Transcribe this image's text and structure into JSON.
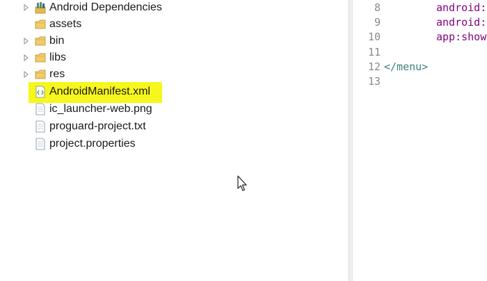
{
  "explorer": {
    "items": [
      {
        "label": "Android Dependencies",
        "icon": "library-icon",
        "expandable": true
      },
      {
        "label": "assets",
        "icon": "folder-icon",
        "expandable": false
      },
      {
        "label": "bin",
        "icon": "folder-icon",
        "expandable": true
      },
      {
        "label": "libs",
        "icon": "folder-icon",
        "expandable": true
      },
      {
        "label": "res",
        "icon": "folder-icon",
        "expandable": true
      },
      {
        "label": "AndroidManifest.xml",
        "icon": "xml-file-icon",
        "expandable": false,
        "highlighted": true
      },
      {
        "label": "ic_launcher-web.png",
        "icon": "file-icon",
        "expandable": false
      },
      {
        "label": "proguard-project.txt",
        "icon": "file-icon",
        "expandable": false
      },
      {
        "label": "project.properties",
        "icon": "file-icon",
        "expandable": false
      }
    ]
  },
  "editor": {
    "line_numbers": [
      "8",
      "9",
      "10",
      "11",
      "12",
      "13"
    ],
    "lines": [
      {
        "attr": "android:",
        "tag": ""
      },
      {
        "attr": "android:",
        "tag": ""
      },
      {
        "attr": "app:show",
        "tag": ""
      },
      {
        "attr": "",
        "tag": ""
      },
      {
        "attr": "",
        "tag": "</menu>"
      },
      {
        "attr": "",
        "tag": ""
      }
    ]
  },
  "colors": {
    "highlight": "#f6f71c",
    "folder": "#e8b84a",
    "attr": "#7f007f",
    "tag": "#3f7f7f"
  }
}
